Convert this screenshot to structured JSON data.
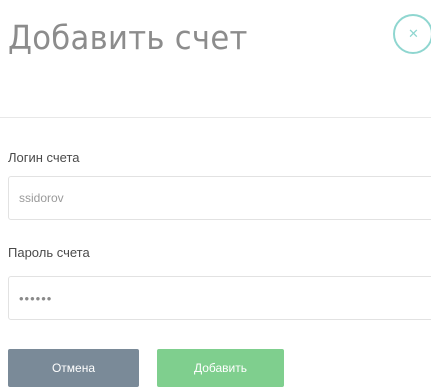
{
  "dialog": {
    "title": "Добавить счет",
    "close_icon": "close-icon",
    "close_glyph": "✕"
  },
  "form": {
    "login": {
      "label": "Логин счета",
      "value": "ssidorov"
    },
    "password": {
      "label": "Пароль счета",
      "value": "••••••"
    }
  },
  "actions": {
    "cancel_label": "Отмена",
    "add_label": "Добавить"
  },
  "colors": {
    "accent_close": "#8fd6d0",
    "cancel_button": "#7a8a98",
    "add_button": "#7fcf8e",
    "title_text": "#8c8c8c"
  }
}
